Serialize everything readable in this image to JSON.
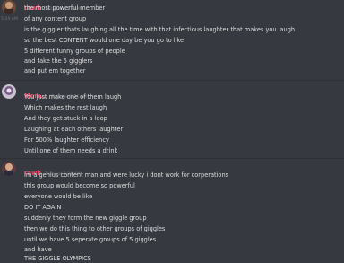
{
  "colors": {
    "background": "#36393f",
    "message_text": "#dcddde",
    "timestamp": "#72767d",
    "username_rawb": "#e94b6b",
    "username_mom": "#e94b6b"
  },
  "messages": [
    {
      "username": "rawb",
      "timestamp": "Today at 5:24 AM",
      "side_time": "5:24 AM",
      "lines": [
        "the most powerful member",
        "of any content group",
        "is the giggler thats laughing all the time with that infectious laughter that makes you laugh",
        "so the best CONTENT would one day be you go to like",
        "5 different funny groups of people",
        "and take the 5 gigglers",
        "and put em together"
      ]
    },
    {
      "username": "Mom...",
      "timestamp": "Today at 5:26 AM",
      "lines": [
        "You just make one of them laugh",
        "Which makes the rest laugh",
        "And they get stuck in a loop",
        "Laughing at each others laughter",
        "For 500% laughter efficiency",
        "Until one of them needs a drink"
      ]
    },
    {
      "username": "rawb",
      "timestamp": "Today at 5:28 AM",
      "lines": [
        "im a genius content man and were lucky i dont work for corperations",
        "this group would become so powerful",
        "everyone would be like",
        "DO IT AGAIN",
        "suddenly they form the new giggle group",
        "then we do this thing to other groups of giggles",
        "until we have 5 seperate groups of 5 giggles",
        "and have",
        "THE GIGGLE OLYMPICS"
      ]
    }
  ]
}
